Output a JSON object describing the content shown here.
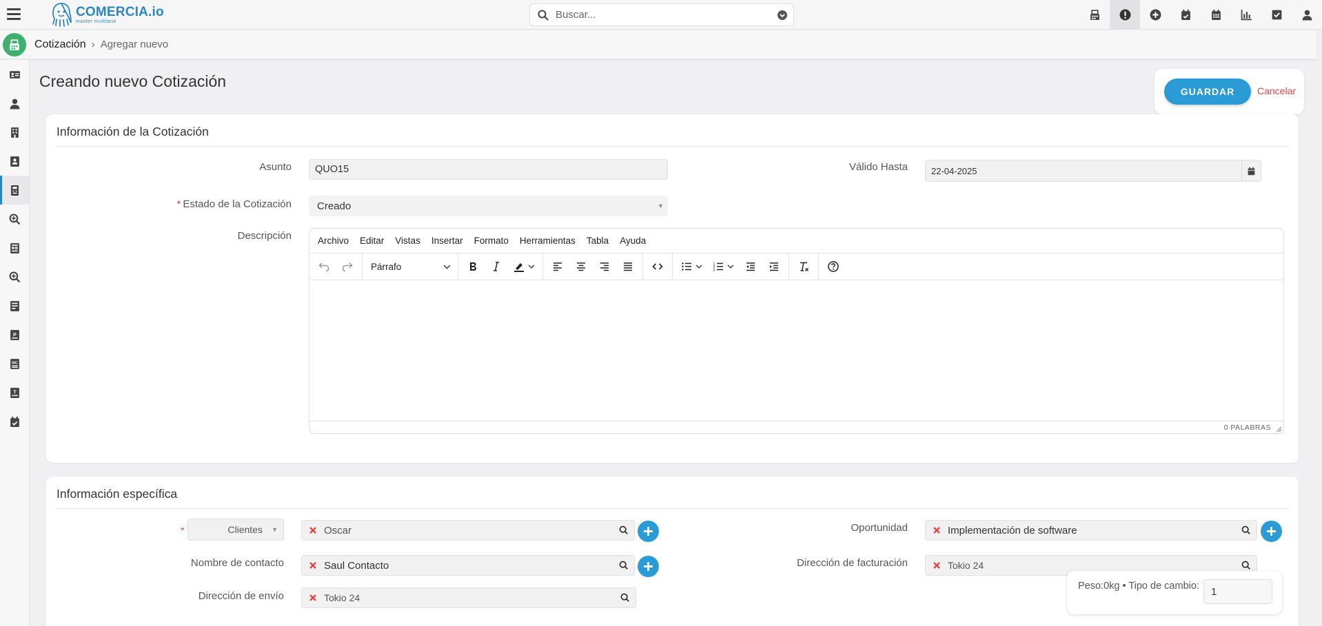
{
  "app": {
    "logo_name": "COMERCIA.io",
    "logo_tagline": "master multitask"
  },
  "search": {
    "placeholder": "Buscar..."
  },
  "top_icons": [
    "calculator-icon",
    "alert-icon",
    "plus-circle-icon",
    "calendar-check-icon",
    "calendar-icon",
    "bar-chart-icon",
    "checkbox-icon",
    "user-icon"
  ],
  "breadcrumb": {
    "module": "Cotización",
    "current": "Agregar nuevo"
  },
  "sidebar_icons": [
    "id-card-icon",
    "user-icon",
    "building-icon",
    "contact-book-icon",
    "quote-icon",
    "search-plus-icon",
    "invoice-icon",
    "search-plus-icon",
    "book-icon",
    "p-document-icon",
    "nc-document-icon",
    "t-document-icon",
    "calendar-check-icon"
  ],
  "page": {
    "title": "Creando nuevo Cotización"
  },
  "actions": {
    "save_label": "GUARDAR",
    "cancel_label": "Cancelar"
  },
  "section1": {
    "title": "Información de la Cotización",
    "asunto_label": "Asunto",
    "asunto_value": "QUO15",
    "valido_label": "Válido Hasta",
    "valido_value": "22-04-2025",
    "estado_required": "*",
    "estado_label": "Estado de la Cotización",
    "estado_value": "Creado",
    "descripcion_label": "Descripción"
  },
  "editor": {
    "menus": [
      "Archivo",
      "Editar",
      "Vistas",
      "Insertar",
      "Formato",
      "Herramientas",
      "Tabla",
      "Ayuda"
    ],
    "block_format": "Párrafo",
    "word_count": "0 PALABRAS"
  },
  "section2": {
    "title": "Información específica",
    "module_required": "*",
    "module_select": "Clientes",
    "client_value": "Oscar",
    "oportunidad_label": "Oportunidad",
    "oportunidad_value": "Implementación de software",
    "contacto_label": "Nombre de contacto",
    "contacto_value": "Saul Contacto",
    "facturacion_label": "Dirección de facturación",
    "facturacion_value": "Tokio 24",
    "envio_label": "Dirección de envío",
    "envio_value": "Tokio 24"
  },
  "summary": {
    "label": "Peso:0kg • Tipo de cambio:",
    "exchange_rate": "1"
  },
  "colors": {
    "primary": "#2b9bd5",
    "brand": "#2a86c6",
    "danger": "#e14545",
    "module_badge": "#3fb06d"
  }
}
